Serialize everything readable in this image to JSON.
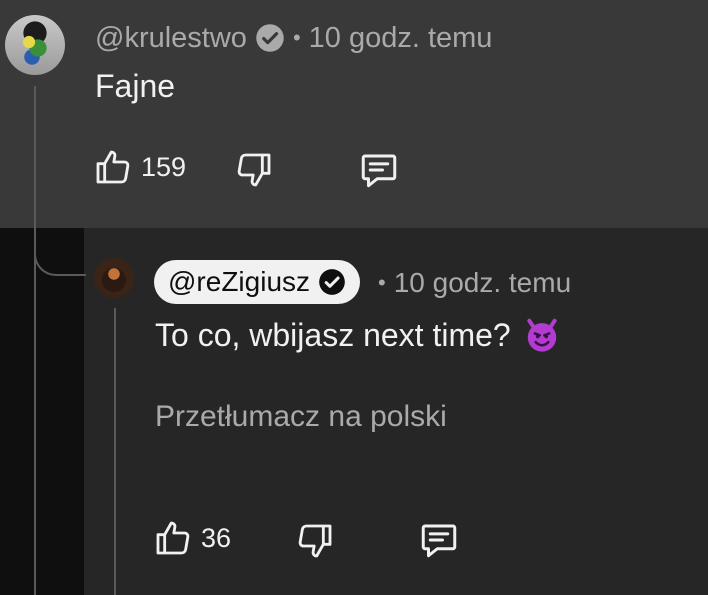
{
  "comment": {
    "author": "@krulestwo",
    "separator": "•",
    "time": "10 godz. temu",
    "text": "Fajne",
    "likes": "159"
  },
  "reply": {
    "author": "@reZigiusz",
    "separator": "•",
    "time": "10 godz. temu",
    "text": "To co, wbijasz next time?",
    "emoji": "smiling-imp-emoji",
    "translate_label": "Przetłumacz na polski",
    "likes": "36"
  },
  "colors": {
    "comment_bg": "#393939",
    "reply_bg": "#262626",
    "muted_text": "#aaaaaa",
    "text": "#f1f1f1",
    "pill_bg": "#f1f1f1"
  }
}
